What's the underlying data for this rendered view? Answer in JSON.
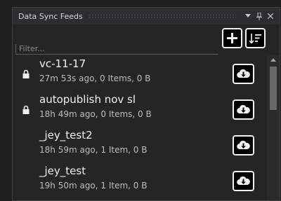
{
  "panel": {
    "title": "Data Sync Feeds",
    "title_buttons": [
      {
        "icon": "dropdown-arrow-icon",
        "glyph": "▾"
      },
      {
        "icon": "pin-icon",
        "glyph": "ꟾ"
      },
      {
        "icon": "close-icon",
        "glyph": "✕"
      }
    ]
  },
  "toolbar": {
    "filter_placeholder": "Filter...",
    "filter_value": "",
    "add_icon": "plus-icon",
    "sort_icon": "sort-icon"
  },
  "feeds": [
    {
      "name": "vc-11-17",
      "meta": "27m 53s ago, 0 Items, 0 B",
      "locked": true
    },
    {
      "name": "autopublish nov sl",
      "meta": "18h 49m ago, 0 Items, 0 B",
      "locked": true
    },
    {
      "name": "_jey_test2",
      "meta": "18h 59m ago, 1 Item, 0 B",
      "locked": false
    },
    {
      "name": "_jey_test",
      "meta": "19h 50m ago, 1 Item, 0 B",
      "locked": false
    }
  ],
  "colors": {
    "background": "#252526",
    "titlebar": "#2d2d30",
    "text": "#f2f2f2",
    "meta_text": "#bdbdbd",
    "button_bg": "#000000",
    "button_border": "#f2f2f2"
  }
}
